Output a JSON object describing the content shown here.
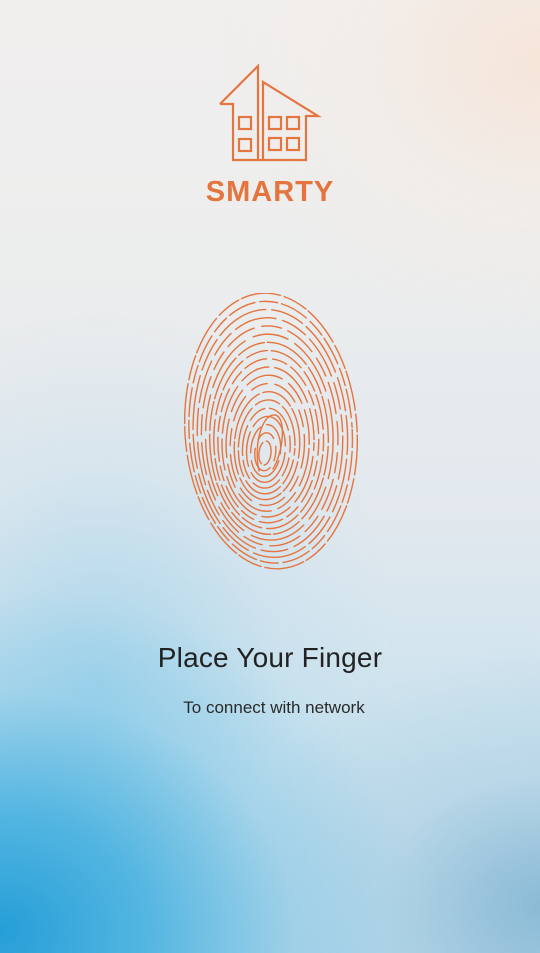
{
  "brand": {
    "name": "SMARTY",
    "icon": "house-icon",
    "accent_color": "#e4753f"
  },
  "scanner": {
    "icon": "fingerprint-icon",
    "color": "#e4753f"
  },
  "prompt": {
    "title": "Place Your Finger",
    "subtitle": "To connect with network"
  }
}
